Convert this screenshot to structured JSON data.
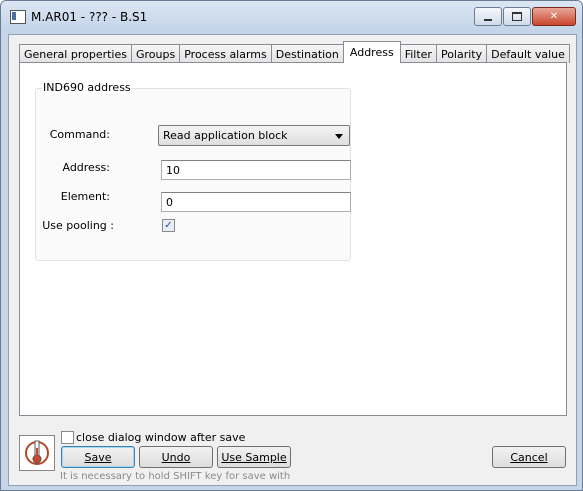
{
  "window": {
    "title": "M.AR01 - ??? - B.S1",
    "minimize_glyph": "",
    "maximize_glyph": "",
    "close_glyph": "✕"
  },
  "tabs": [
    {
      "label": "General properties"
    },
    {
      "label": "Groups"
    },
    {
      "label": "Process alarms"
    },
    {
      "label": "Destination"
    },
    {
      "label": "Address"
    },
    {
      "label": "Filter"
    },
    {
      "label": "Polarity"
    },
    {
      "label": "Default value"
    }
  ],
  "address_group": {
    "title": "IND690 address",
    "command_label": "Command:",
    "command_value": "Read application block",
    "address_label": "Address:",
    "address_value": "10",
    "element_label": "Element:",
    "element_value": "0",
    "pooling_label": "Use pooling :",
    "pooling_check": "✓"
  },
  "footer": {
    "close_after_save_label": "close dialog window after save",
    "save_label": "Save",
    "undo_label": "Undo",
    "use_sample_label": "Use Sample",
    "cancel_label": "Cancel",
    "hint": "It is necessary to hold SHIFT key for save with"
  },
  "colors": {
    "active_tab_bg": "#ffffff",
    "frame": "#c6d5e8",
    "close_button": "#c9462c"
  }
}
